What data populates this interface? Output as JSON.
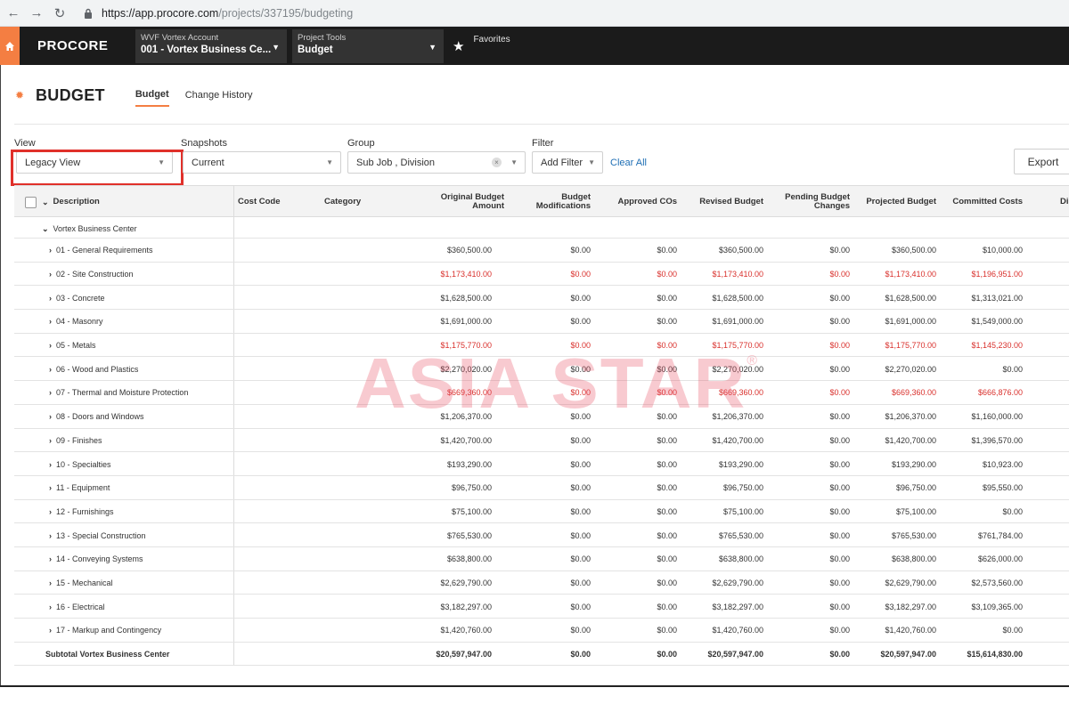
{
  "browser": {
    "url_host": "https://app.procore.com",
    "url_path": "/projects/337195/budgeting"
  },
  "header": {
    "logo": "PROCORE",
    "account_top": "WVF Vortex Account",
    "account_bottom": "001 - Vortex Business Ce...",
    "tools_top": "Project Tools",
    "tools_bottom": "Budget",
    "favorites": "Favorites"
  },
  "page": {
    "title": "BUDGET",
    "tabs": [
      "Budget",
      "Change History"
    ]
  },
  "filters": {
    "view_label": "View",
    "view_value": "Legacy View",
    "snapshots_label": "Snapshots",
    "snapshots_value": "Current",
    "group_label": "Group",
    "group_value": "Sub Job , Division",
    "filter_label": "Filter",
    "filter_value": "Add Filter",
    "clear_all": "Clear All",
    "export": "Export"
  },
  "table": {
    "headers": {
      "description": "Description",
      "cost_code": "Cost Code",
      "category": "Category",
      "original_budget": [
        "Original Budget",
        "Amount"
      ],
      "budget_mods": [
        "Budget",
        "Modifications"
      ],
      "approved_cos": "Approved COs",
      "revised_budget": "Revised Budget",
      "pending_changes": [
        "Pending Budget",
        "Changes"
      ],
      "projected_budget": "Projected Budget",
      "committed_costs": "Committed Costs",
      "cut_off": "Di"
    },
    "group_name": "Vortex Business Center",
    "rows": [
      {
        "desc": "01 - General Requirements",
        "orig": "$360,500.00",
        "mods": "$0.00",
        "cos": "$0.00",
        "revised": "$360,500.00",
        "pending": "$0.00",
        "projected": "$360,500.00",
        "committed": "$10,000.00",
        "red": false
      },
      {
        "desc": "02 - Site Construction",
        "orig": "$1,173,410.00",
        "mods": "$0.00",
        "cos": "$0.00",
        "revised": "$1,173,410.00",
        "pending": "$0.00",
        "projected": "$1,173,410.00",
        "committed": "$1,196,951.00",
        "red": true
      },
      {
        "desc": "03 - Concrete",
        "orig": "$1,628,500.00",
        "mods": "$0.00",
        "cos": "$0.00",
        "revised": "$1,628,500.00",
        "pending": "$0.00",
        "projected": "$1,628,500.00",
        "committed": "$1,313,021.00",
        "red": false
      },
      {
        "desc": "04 - Masonry",
        "orig": "$1,691,000.00",
        "mods": "$0.00",
        "cos": "$0.00",
        "revised": "$1,691,000.00",
        "pending": "$0.00",
        "projected": "$1,691,000.00",
        "committed": "$1,549,000.00",
        "red": false
      },
      {
        "desc": "05 - Metals",
        "orig": "$1,175,770.00",
        "mods": "$0.00",
        "cos": "$0.00",
        "revised": "$1,175,770.00",
        "pending": "$0.00",
        "projected": "$1,175,770.00",
        "committed": "$1,145,230.00",
        "red": true
      },
      {
        "desc": "06 - Wood and Plastics",
        "orig": "$2,270,020.00",
        "mods": "$0.00",
        "cos": "$0.00",
        "revised": "$2,270,020.00",
        "pending": "$0.00",
        "projected": "$2,270,020.00",
        "committed": "$0.00",
        "red": false
      },
      {
        "desc": "07 - Thermal and Moisture Protection",
        "orig": "$669,360.00",
        "mods": "$0.00",
        "cos": "$0.00",
        "revised": "$669,360.00",
        "pending": "$0.00",
        "projected": "$669,360.00",
        "committed": "$666,876.00",
        "red": true
      },
      {
        "desc": "08 - Doors and Windows",
        "orig": "$1,206,370.00",
        "mods": "$0.00",
        "cos": "$0.00",
        "revised": "$1,206,370.00",
        "pending": "$0.00",
        "projected": "$1,206,370.00",
        "committed": "$1,160,000.00",
        "red": false
      },
      {
        "desc": "09 - Finishes",
        "orig": "$1,420,700.00",
        "mods": "$0.00",
        "cos": "$0.00",
        "revised": "$1,420,700.00",
        "pending": "$0.00",
        "projected": "$1,420,700.00",
        "committed": "$1,396,570.00",
        "red": false
      },
      {
        "desc": "10 - Specialties",
        "orig": "$193,290.00",
        "mods": "$0.00",
        "cos": "$0.00",
        "revised": "$193,290.00",
        "pending": "$0.00",
        "projected": "$193,290.00",
        "committed": "$10,923.00",
        "red": false
      },
      {
        "desc": "11 - Equipment",
        "orig": "$96,750.00",
        "mods": "$0.00",
        "cos": "$0.00",
        "revised": "$96,750.00",
        "pending": "$0.00",
        "projected": "$96,750.00",
        "committed": "$95,550.00",
        "red": false
      },
      {
        "desc": "12 - Furnishings",
        "orig": "$75,100.00",
        "mods": "$0.00",
        "cos": "$0.00",
        "revised": "$75,100.00",
        "pending": "$0.00",
        "projected": "$75,100.00",
        "committed": "$0.00",
        "red": false
      },
      {
        "desc": "13 - Special Construction",
        "orig": "$765,530.00",
        "mods": "$0.00",
        "cos": "$0.00",
        "revised": "$765,530.00",
        "pending": "$0.00",
        "projected": "$765,530.00",
        "committed": "$761,784.00",
        "red": false
      },
      {
        "desc": "14 - Conveying Systems",
        "orig": "$638,800.00",
        "mods": "$0.00",
        "cos": "$0.00",
        "revised": "$638,800.00",
        "pending": "$0.00",
        "projected": "$638,800.00",
        "committed": "$626,000.00",
        "red": false
      },
      {
        "desc": "15 - Mechanical",
        "orig": "$2,629,790.00",
        "mods": "$0.00",
        "cos": "$0.00",
        "revised": "$2,629,790.00",
        "pending": "$0.00",
        "projected": "$2,629,790.00",
        "committed": "$2,573,560.00",
        "red": false
      },
      {
        "desc": "16 - Electrical",
        "orig": "$3,182,297.00",
        "mods": "$0.00",
        "cos": "$0.00",
        "revised": "$3,182,297.00",
        "pending": "$0.00",
        "projected": "$3,182,297.00",
        "committed": "$3,109,365.00",
        "red": false
      },
      {
        "desc": "17 - Markup and Contingency",
        "orig": "$1,420,760.00",
        "mods": "$0.00",
        "cos": "$0.00",
        "revised": "$1,420,760.00",
        "pending": "$0.00",
        "projected": "$1,420,760.00",
        "committed": "$0.00",
        "red": false
      }
    ],
    "subtotal": {
      "desc": "Subtotal Vortex Business Center",
      "orig": "$20,597,947.00",
      "mods": "$0.00",
      "cos": "$0.00",
      "revised": "$20,597,947.00",
      "pending": "$0.00",
      "projected": "$20,597,947.00",
      "committed": "$15,614,830.00"
    }
  },
  "watermark": {
    "text": "ASIA STAR",
    "mark": "®"
  },
  "colors": {
    "accent": "#f47e42",
    "negative": "#d9302c",
    "link": "#1f6fb5",
    "highlight": "#e0302a"
  }
}
